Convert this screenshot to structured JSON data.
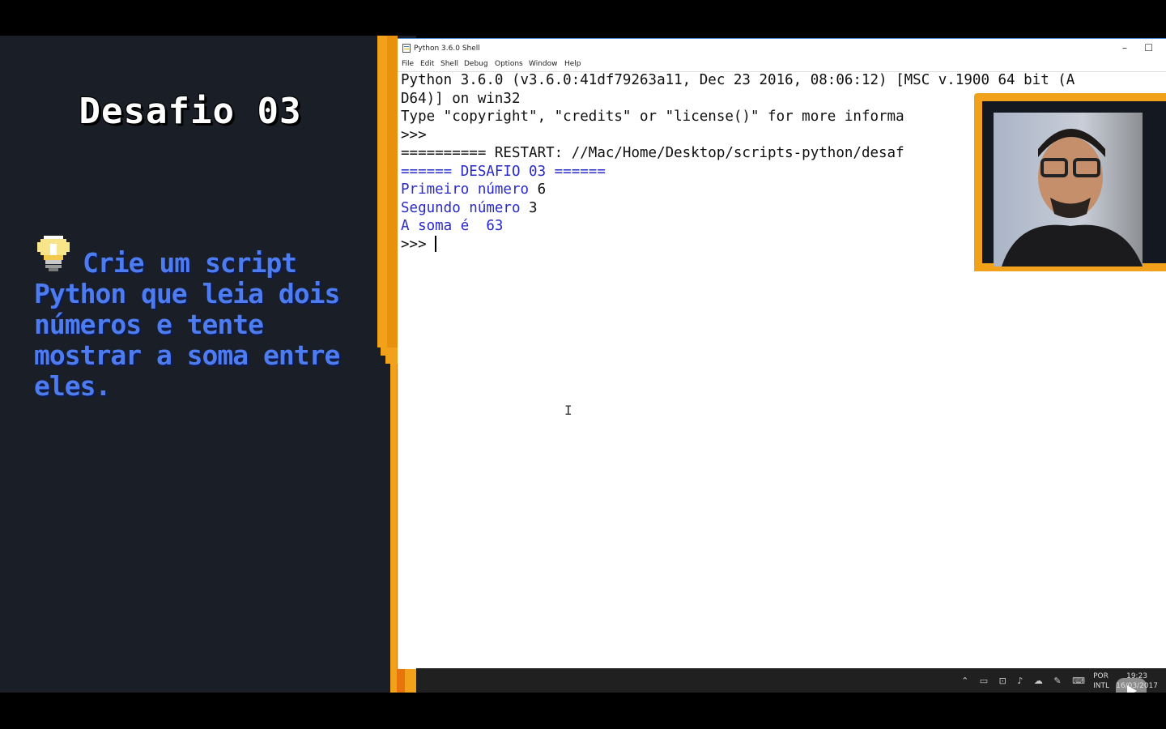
{
  "left_panel": {
    "title": "Desafio 03",
    "challenge_text": "Crie um script Python que leia dois números e tente mostrar a soma entre eles."
  },
  "idle": {
    "window_title": "Python 3.6.0 Shell",
    "menu": [
      "File",
      "Edit",
      "Shell",
      "Debug",
      "Options",
      "Window",
      "Help"
    ],
    "lines": {
      "l1": "Python 3.6.0 (v3.6.0:41df79263a11, Dec 23 2016, 08:06:12) [MSC v.1900 64 bit (A",
      "l2": "D64)] on win32",
      "l3": "Type \"copyright\", \"credits\" or \"license()\" for more informa",
      "l4": ">>> ",
      "l5": "========== RESTART: //Mac/Home/Desktop/scripts-python/desaf",
      "l6": "====== DESAFIO 03 ======",
      "l7_prompt": "Primeiro número ",
      "l7_value": "6",
      "l8_prompt": "Segundo número ",
      "l8_value": "3",
      "l9_prompt": "A soma é  ",
      "l9_value": "63",
      "l10": ">>> "
    }
  },
  "taskbar": {
    "lang_top": "POR",
    "lang_bottom": "INTL",
    "time": "19:23",
    "date": "16/03/2017"
  },
  "colors": {
    "accent_orange": "#f2a21a",
    "panel_dark": "#1a1f27",
    "challenge_blue": "#4d7cf0",
    "idle_output_blue": "#2a2ac8"
  }
}
